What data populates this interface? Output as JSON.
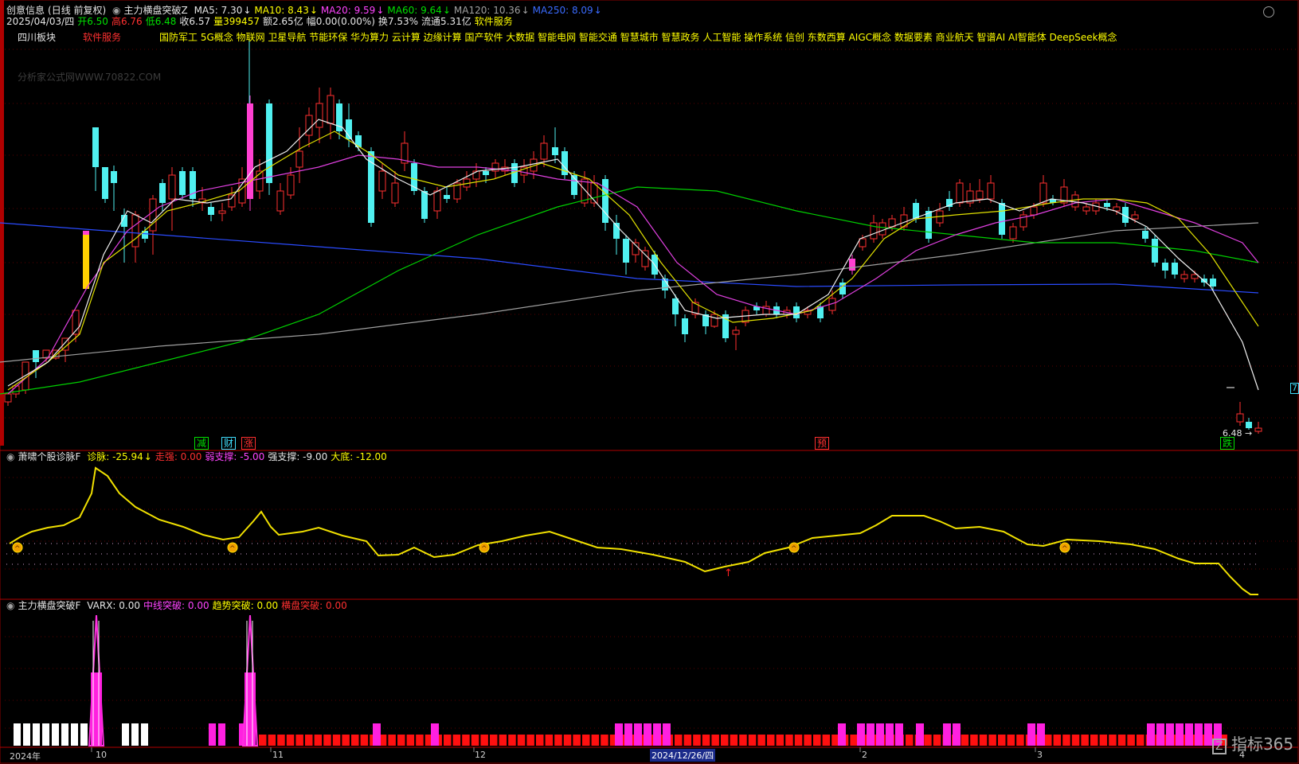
{
  "header": {
    "stock_name": "创意信息",
    "mode": "(日线 前复权)",
    "indicator_name": "主力横盘突破Z",
    "ma_lines": [
      {
        "label": "MA5: 7.30",
        "color": "#e6e6e6",
        "arrow": "↓"
      },
      {
        "label": "MA10: 8.43",
        "color": "#ffff00",
        "arrow": "↓"
      },
      {
        "label": "MA20: 9.59",
        "color": "#ff44ff",
        "arrow": "↓"
      },
      {
        "label": "MA60: 9.64",
        "color": "#00e000",
        "arrow": "↓"
      },
      {
        "label": "MA120: 10.36",
        "color": "#a0a0a0",
        "arrow": "↓"
      },
      {
        "label": "MA250: 8.09",
        "color": "#3a6bff",
        "arrow": "↓"
      }
    ],
    "date": "2025/04/03/四",
    "open": "开6.50",
    "high": "高6.76",
    "low": "低6.48",
    "close": "收6.57",
    "volume": "量399457",
    "amount": "额2.65亿",
    "amp": "幅0.00(0.00%)",
    "turnover": "换7.53%",
    "float_cap": "流通5.31亿",
    "sector": "软件服务"
  },
  "concepts": {
    "region": "四川板块",
    "industry": "软件服务",
    "list": "国防军工 5G概念 物联网 卫星导航 节能环保 华为算力 云计算 边缘计算 国产软件 大数据 智能电网 智能交通 智慧城市 智慧政务 人工智能 操作系统 信创 东数西算 AIGC概念 数据要素 商业航天 智谱AI AI智能体 DeepSeek概念"
  },
  "watermark": "分析家公式网WWW.70822.COM",
  "signals": [
    {
      "text": "减",
      "color": "#00e000"
    },
    {
      "text": "财",
      "color": "#40e0ff"
    },
    {
      "text": "涨",
      "color": "#ff3030"
    },
    {
      "text": "预",
      "color": "#ff3030"
    },
    {
      "text": "跌",
      "color": "#00e000"
    }
  ],
  "price_label": "6.48",
  "right_marker": "7",
  "panel2": {
    "name": "萧啸个股诊脉F",
    "items": [
      {
        "label": "诊脉: -25.94",
        "color": "#ffff00",
        "arrow": "↓"
      },
      {
        "label": "走强: 0.00",
        "color": "#ff3030"
      },
      {
        "label": "弱支撑: -5.00",
        "color": "#ff44ff"
      },
      {
        "label": "强支撑: -9.00",
        "color": "#e6e6e6"
      },
      {
        "label": "大底: -12.00",
        "color": "#ffff00"
      }
    ]
  },
  "panel3": {
    "name": "主力横盘突破F",
    "items": [
      {
        "label": "VARX: 0.00",
        "color": "#e6e6e6"
      },
      {
        "label": "中线突破: 0.00",
        "color": "#ff44ff"
      },
      {
        "label": "趋势突破: 0.00",
        "color": "#ffff00"
      },
      {
        "label": "横盘突破: 0.00",
        "color": "#ff3030"
      }
    ]
  },
  "xaxis": {
    "labels": [
      "2024年",
      "10",
      "11",
      "12",
      "2024/12/26/四",
      "2",
      "3",
      "4"
    ]
  },
  "logo": "指标365"
}
